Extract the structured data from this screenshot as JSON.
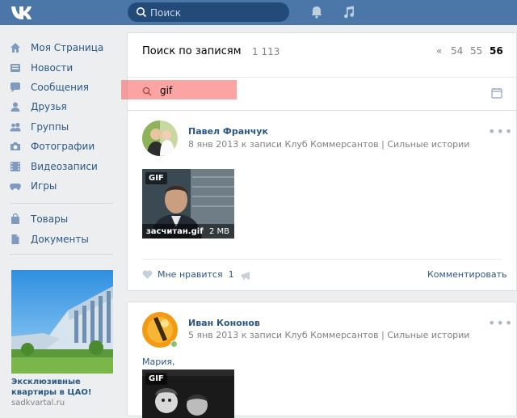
{
  "header": {
    "logo": "vk-logo",
    "search_placeholder": "Поиск",
    "icons": [
      "bell-icon",
      "music-icon"
    ]
  },
  "sidebar": {
    "items": [
      {
        "label": "Моя Страница",
        "icon": "home-icon"
      },
      {
        "label": "Новости",
        "icon": "news-icon"
      },
      {
        "label": "Сообщения",
        "icon": "messages-icon"
      },
      {
        "label": "Друзья",
        "icon": "friend-icon"
      },
      {
        "label": "Группы",
        "icon": "groups-icon"
      },
      {
        "label": "Фотографии",
        "icon": "camera-icon"
      },
      {
        "label": "Видеозаписи",
        "icon": "video-icon"
      },
      {
        "label": "Игры",
        "icon": "gamepad-icon"
      }
    ],
    "items2": [
      {
        "label": "Товары",
        "icon": "bag-icon"
      },
      {
        "label": "Документы",
        "icon": "document-icon"
      }
    ],
    "ad": {
      "title": "Эксклюзивные квартиры в ЦАО!",
      "url": "sadkvartal.ru"
    }
  },
  "results": {
    "title": "Поиск по записям",
    "count": "1 113",
    "pager": {
      "prev": "«",
      "pages": [
        "54",
        "55",
        "56"
      ],
      "current": "56"
    },
    "query": "gif"
  },
  "posts": [
    {
      "author": "Павел Франчук",
      "meta": "8 янв 2013 к записи Клуб Коммерсантов | Сильные истории",
      "gif": {
        "badge": "GIF",
        "name": "засчитан.gif",
        "size": "2 MB"
      },
      "like_label": "Мне нравится",
      "like_count": "1",
      "comment_label": "Комментировать"
    },
    {
      "author": "Иван Кононов",
      "meta": "5 янв 2013 к записи Клуб Коммерсантов | Сильные истории",
      "text": "Мария,",
      "gif": {
        "badge": "GIF"
      }
    }
  ],
  "colors": {
    "header": "#4a76a8",
    "link": "#2a5885",
    "bg": "#edeef0"
  }
}
